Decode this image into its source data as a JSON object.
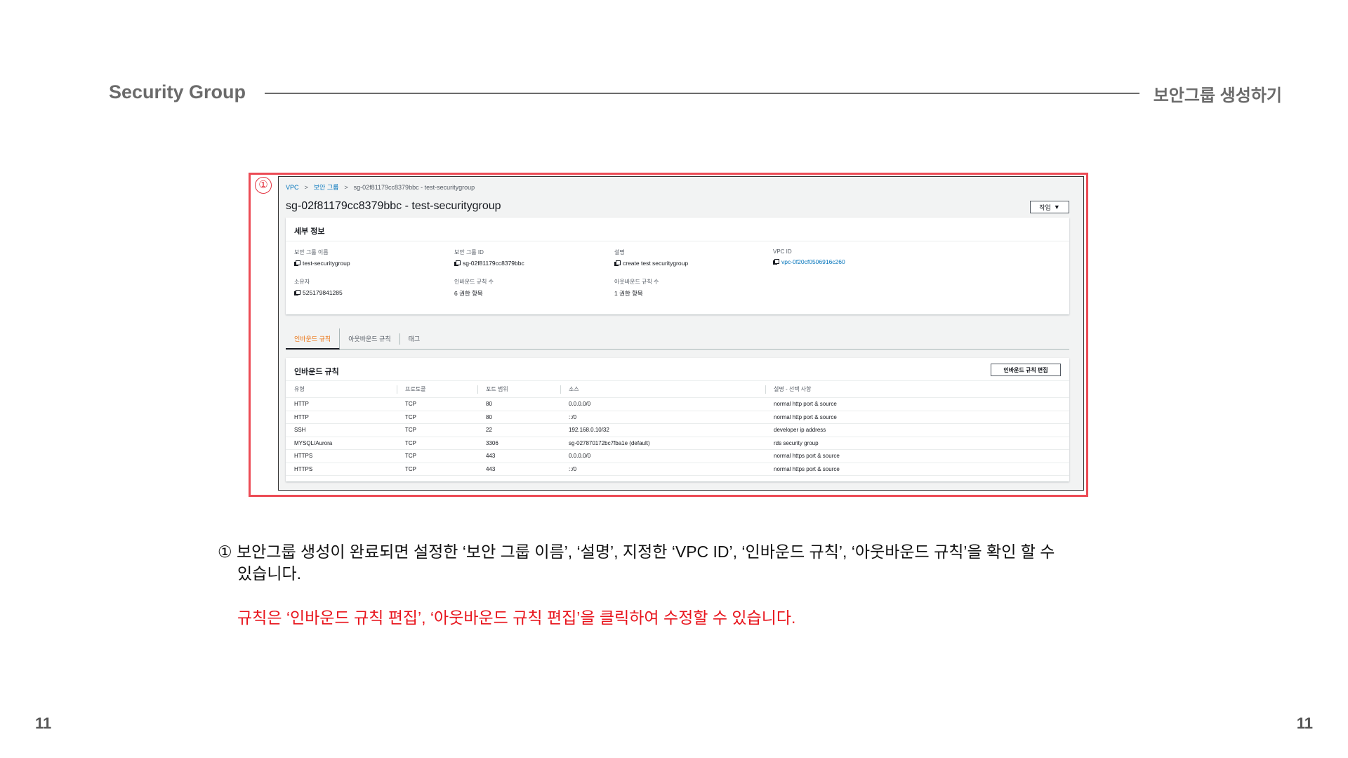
{
  "slide": {
    "title_left": "Security Group",
    "title_right": "보안그룹 생성하기",
    "page_left": "11",
    "page_right": "11",
    "step_marker": "①"
  },
  "console": {
    "breadcrumb": [
      "VPC",
      "보안 그룹",
      "sg-02f81179cc8379bbc - test-securitygroup"
    ],
    "title": "sg-02f81179cc8379bbc - test-securitygroup",
    "actions_label": "작업",
    "details": {
      "header": "세부 정보",
      "items": [
        {
          "label": "보안 그룹 이름",
          "value": "test-securitygroup",
          "copy": true
        },
        {
          "label": "보안 그룹 ID",
          "value": "sg-02f81179cc8379bbc",
          "copy": true
        },
        {
          "label": "설명",
          "value": "create test securitygroup",
          "copy": true
        },
        {
          "label": "VPC ID",
          "value": "vpc-0f20cf0506916c260",
          "copy": true,
          "link": true
        },
        {
          "label": "소유자",
          "value": "525179841285",
          "copy": true
        },
        {
          "label": "인바운드 규칙 수",
          "value": "6 권한 항목"
        },
        {
          "label": "아웃바운드 규칙 수",
          "value": "1 권한 항목"
        }
      ]
    },
    "tabs": [
      "인바운드 규칙",
      "아웃바운드 규칙",
      "태그"
    ],
    "rules": {
      "header": "인바운드 규칙",
      "edit_label": "인바운드 규칙 편집",
      "columns": [
        "유형",
        "프로토콜",
        "포트 범위",
        "소스",
        "설명 - 선택 사항"
      ],
      "rows": [
        [
          "HTTP",
          "TCP",
          "80",
          "0.0.0.0/0",
          "normal http port & source"
        ],
        [
          "HTTP",
          "TCP",
          "80",
          "::/0",
          "normal http port & source"
        ],
        [
          "SSH",
          "TCP",
          "22",
          "192.168.0.10/32",
          "developer ip address"
        ],
        [
          "MYSQL/Aurora",
          "TCP",
          "3306",
          "sg-027870172bc7fba1e (default)",
          "rds security group"
        ],
        [
          "HTTPS",
          "TCP",
          "443",
          "0.0.0.0/0",
          "normal https port & source"
        ],
        [
          "HTTPS",
          "TCP",
          "443",
          "::/0",
          "normal https port & source"
        ]
      ]
    }
  },
  "description": {
    "line1": "① 보안그룹 생성이 완료되면 설정한 ‘보안 그룹 이름’, ‘설명’, 지정한 ‘VPC ID’, ‘인바운드 규칙’, ‘아웃바운드 규칙’을 확인 할 수",
    "line2": "있습니다.",
    "note": "규칙은 ‘인바운드 규칙 편집’, ‘아웃바운드 규칙 편집’을 클릭하여 수정할 수 있습니다."
  },
  "colors": {
    "accent_red": "#e8141c",
    "frame_red": "#ec4b55",
    "link_blue": "#0073bb",
    "tab_orange": "#ec7211"
  }
}
